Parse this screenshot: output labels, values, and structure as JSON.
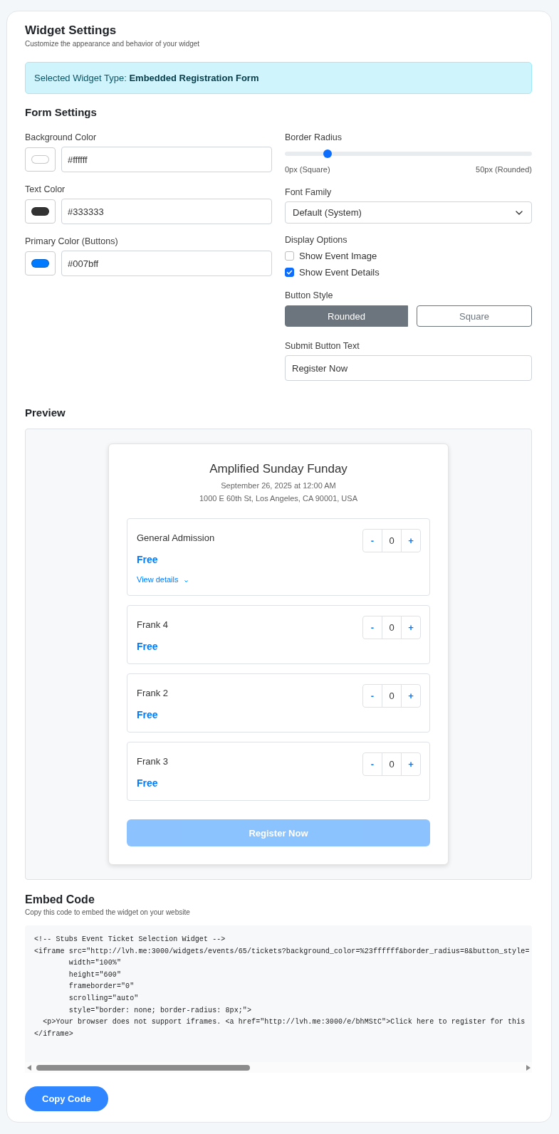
{
  "header": {
    "title": "Widget Settings",
    "subtitle": "Customize the appearance and behavior of your widget"
  },
  "banner": {
    "text": "Selected Widget Type: **Embedded Registration Form**"
  },
  "form_settings": {
    "title": "Form Settings",
    "colors": [
      {
        "label": "Background Color",
        "value": "#ffffff",
        "color": "#ffffff"
      },
      {
        "label": "Text Color",
        "value": "#333333",
        "color": "#333333"
      },
      {
        "label": "Primary Color (Buttons)",
        "value": "#007bff",
        "color": "#007bff"
      }
    ],
    "border_radius": {
      "label": "Border Radius",
      "level": 0.16,
      "min_label": "0px (Square)",
      "max_label": "50px (Rounded)"
    },
    "font_family": {
      "label": "Font Family",
      "value": "Default (System)"
    },
    "display_options": {
      "label": "Display Options",
      "items": [
        {
          "label": "Show Event Image",
          "checked": false
        },
        {
          "label": "Show Event Details",
          "checked": true
        }
      ]
    },
    "button_style": {
      "label": "Button Style",
      "options": [
        {
          "label": "Rounded",
          "selected": true
        },
        {
          "label": "Square",
          "selected": false
        }
      ]
    },
    "submit_button_text": {
      "label": "Submit Button Text",
      "value": "Register Now"
    }
  },
  "preview": {
    "title": "Preview",
    "event": {
      "name": "Amplified Sunday Funday",
      "date": "September 26, 2025 at 12:00 AM",
      "address": "1000 E 60th St, Los Angeles, CA 90001, USA"
    },
    "tickets": [
      {
        "name": "General Admission",
        "price": "Free",
        "details_link": "View details",
        "minus": "-",
        "quantity": "0",
        "plus": "+"
      },
      {
        "name": "Frank 4",
        "price": "Free",
        "minus": "-",
        "quantity": "0",
        "plus": "+"
      },
      {
        "name": "Frank 2",
        "price": "Free",
        "minus": "-",
        "quantity": "0",
        "plus": "+"
      },
      {
        "name": "Frank 3",
        "price": "Free",
        "minus": "-",
        "quantity": "0",
        "plus": "+"
      }
    ],
    "submit_button": {
      "label": "Register Now",
      "disabled": true
    }
  },
  "embed_code": {
    "title": "Embed Code",
    "subtitle": "Copy this code to embed the widget on your website",
    "lines": [
      "<!-- Stubs Event Ticket Selection Widget -->",
      "<iframe src=\"http://lvh.me:3000/widgets/events/65/tickets?background_color=%23ffffff&border_radius=8&button_style=",
      "        width=\"100%\"",
      "        height=\"600\"",
      "        frameborder=\"0\"",
      "        scrolling=\"auto\"",
      "        style=\"border: none; border-radius: 8px;\">",
      "  <p>Your browser does not support iframes. <a href=\"http://lvh.me:3000/e/bhMStC\">Click here to register for this",
      "</iframe>"
    ],
    "copy_button": "Copy Code"
  }
}
